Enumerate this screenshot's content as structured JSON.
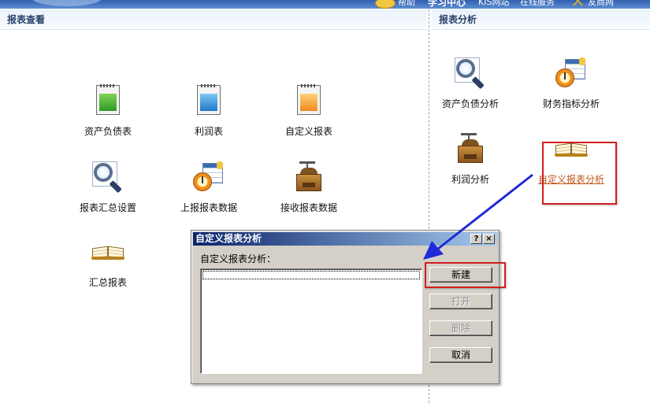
{
  "topbar": {
    "help": "帮助",
    "learning_center": "学习中心",
    "kis_site": "KIS网站",
    "online_service": "在线服务",
    "partner_site": "友商网"
  },
  "left_panel": {
    "title": "报表查看",
    "tiles": [
      {
        "label": "资产负债表",
        "icon": "green-spreadsheet-icon"
      },
      {
        "label": "利润表",
        "icon": "blue-spreadsheet-icon"
      },
      {
        "label": "自定义报表",
        "icon": "orange-spreadsheet-icon"
      },
      {
        "label": "报表汇总设置",
        "icon": "magnifier-icon"
      },
      {
        "label": "上报报表数据",
        "icon": "clock-calendar-icon"
      },
      {
        "label": "接收报表数据",
        "icon": "grinder-icon"
      },
      {
        "label": "汇总报表",
        "icon": "open-book-icon"
      }
    ]
  },
  "right_panel": {
    "title": "报表分析",
    "tiles": [
      {
        "label": "资产负债分析",
        "icon": "magnifier-icon"
      },
      {
        "label": "财务指标分析",
        "icon": "clock-calendar-icon"
      },
      {
        "label": "利润分析",
        "icon": "grinder-icon"
      },
      {
        "label": "自定义报表分析",
        "icon": "open-book-icon"
      }
    ]
  },
  "dialog": {
    "title": "自定义报表分析",
    "help_glyph": "?",
    "close_glyph": "×",
    "list_caption": "自定义报表分析：",
    "buttons": {
      "new": "新建",
      "open": "打开",
      "delete": "删除",
      "cancel": "取消"
    }
  },
  "colors": {
    "annotation_red": "#d21f1f",
    "annotation_arrow": "#1f2bd6",
    "link_orange": "#c0591d",
    "titlebar": "#0a246a"
  }
}
